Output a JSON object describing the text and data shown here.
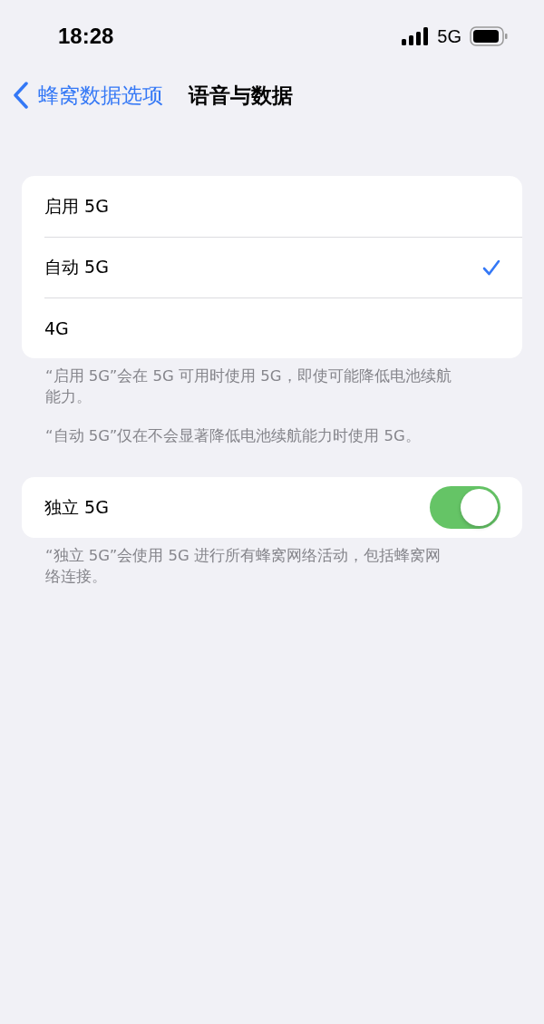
{
  "status_bar": {
    "time": "18:28",
    "network": "5G"
  },
  "nav": {
    "back_label": "蜂窝数据选项",
    "title": "语音与数据"
  },
  "options": [
    {
      "label": "启用 5G",
      "selected": false
    },
    {
      "label": "自动 5G",
      "selected": true
    },
    {
      "label": "4G",
      "selected": false
    }
  ],
  "options_footer": [
    "“启用 5G”会在 5G 可用时使用 5G，即使可能降低电池续航能力。",
    "“自动 5G”仅在不会显著降低电池续航能力时使用 5G。"
  ],
  "standalone": {
    "label": "独立 5G",
    "on": true
  },
  "standalone_footer": "“独立 5G”会使用 5G 进行所有蜂窝网络活动，包括蜂窝网络连接。"
}
